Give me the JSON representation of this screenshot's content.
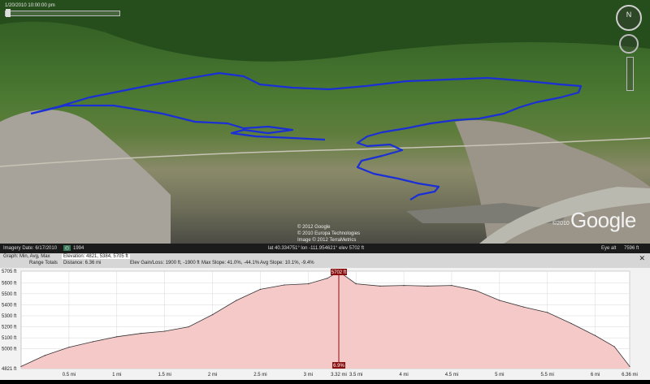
{
  "map": {
    "timeline_date": "1/20/2010  10:00:00 pm",
    "nav_north_label": "N",
    "copyright_lines": [
      "© 2012 Google",
      "© 2010 Europa Technologies",
      "Image © 2012 TerraMetrics"
    ],
    "logo_copyright": "©2010",
    "logo_text": "Google"
  },
  "status": {
    "imagery_date": "Imagery Date: 6/17/2010",
    "year_badge": "1994",
    "coords": "lat  40.334751°  lon -111.954621°  elev  5702 ft",
    "eye_alt_label": "Eye alt",
    "eye_alt_value": "7596 ft"
  },
  "graph": {
    "row1_label": "Graph:  Min, Avg, Max",
    "row1_elev": "Elevation:  4821,  5384,  5705 ft",
    "row2_label": "Range Totals",
    "row2_distance": "Distance:  6.36 mi",
    "row2_gain": "Elev Gain/Loss:  1900 ft,  -1900 ft",
    "row2_maxslope": "Max Slope:  41.0%,  -44.1%",
    "row2_avgslope": "Avg Slope:  10.1%,  -9.4%"
  },
  "colors": {
    "track": "#1b2fd6",
    "profile_fill": "#f6c9c9",
    "profile_line": "#333333",
    "cursor": "#8a0f0f"
  },
  "chart_data": {
    "type": "area",
    "xlabel": "",
    "ylabel": "",
    "x_unit": "mi",
    "y_unit": "ft",
    "xlim": [
      0,
      6.36
    ],
    "ylim": [
      4821,
      5705
    ],
    "y_ticks": [
      "5705 ft",
      "5600 ft",
      "5500 ft",
      "5400 ft",
      "5300 ft",
      "5200 ft",
      "5100 ft",
      "5000 ft",
      "4821 ft"
    ],
    "x_ticks": [
      "0.5 mi",
      "1 mi",
      "1.5 mi",
      "2 mi",
      "2.5 mi",
      "3 mi",
      "3.32 mi",
      "3.5 mi",
      "4 mi",
      "4.5 mi",
      "5 mi",
      "5.5 mi",
      "6 mi",
      "6.36 mi"
    ],
    "cursor": {
      "x": 3.32,
      "elev_label": "5702 ft",
      "slope_label": "6.9%"
    },
    "x": [
      0,
      0.25,
      0.5,
      0.75,
      1,
      1.25,
      1.5,
      1.75,
      2,
      2.25,
      2.5,
      2.75,
      3,
      3.2,
      3.32,
      3.5,
      3.75,
      4,
      4.25,
      4.5,
      4.75,
      5,
      5.25,
      5.5,
      5.75,
      6,
      6.2,
      6.36
    ],
    "y": [
      4840,
      4940,
      5015,
      5065,
      5110,
      5140,
      5160,
      5200,
      5310,
      5440,
      5540,
      5580,
      5590,
      5640,
      5702,
      5590,
      5570,
      5575,
      5570,
      5575,
      5530,
      5440,
      5380,
      5330,
      5230,
      5120,
      5020,
      4840
    ]
  }
}
